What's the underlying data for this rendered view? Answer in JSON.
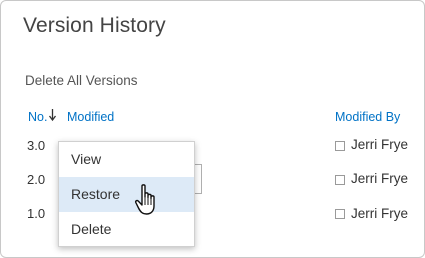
{
  "page": {
    "title": "Version History"
  },
  "actions": {
    "delete_all": "Delete All Versions"
  },
  "table": {
    "headers": {
      "no": "No.",
      "modified": "Modified",
      "modified_by": "Modified By"
    },
    "rows": [
      {
        "version": "3.0",
        "modified_by": "Jerri Frye"
      },
      {
        "version": "2.0",
        "modified_by": "Jerri Frye"
      },
      {
        "version": "1.0",
        "modified_by": "Jerri Frye"
      }
    ]
  },
  "context_menu": {
    "items": [
      {
        "label": "View"
      },
      {
        "label": "Restore",
        "highlighted": true
      },
      {
        "label": "Delete"
      }
    ]
  },
  "colors": {
    "link": "#0072c6",
    "highlight": "#ddeaf7"
  },
  "icons": {
    "sort": "down-arrow-icon",
    "cursor": "hand-pointer-icon"
  }
}
